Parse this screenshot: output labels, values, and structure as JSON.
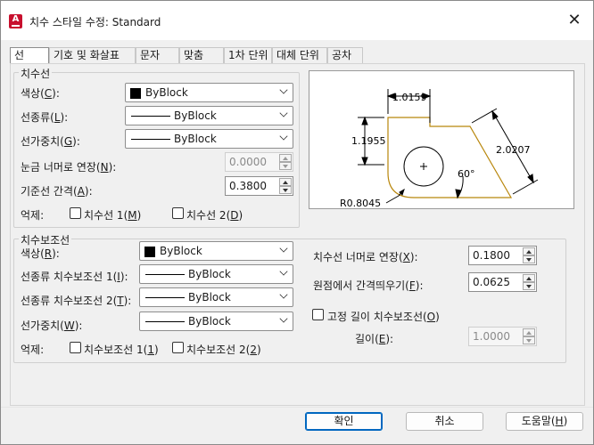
{
  "window": {
    "title": "치수 스타일 수정: Standard"
  },
  "tabs": [
    {
      "label": "선"
    },
    {
      "label": "기호 및 화살표"
    },
    {
      "label": "문자"
    },
    {
      "label": "맞춤"
    },
    {
      "label": "1차 단위"
    },
    {
      "label": "대체 단위"
    },
    {
      "label": "공차"
    }
  ],
  "dim_lines": {
    "title": "치수선",
    "color": {
      "label": "색상(",
      "key": "C",
      "end": "):",
      "value": "ByBlock"
    },
    "linetype": {
      "label": "선종류(",
      "key": "L",
      "end": "):",
      "value": "ByBlock"
    },
    "lineweight": {
      "label": "선가중치(",
      "key": "G",
      "end": "):",
      "value": "ByBlock"
    },
    "extend_ticks": {
      "label": "눈금 너머로 연장(",
      "key": "N",
      "end": "):",
      "value": "0.0000"
    },
    "baseline_spacing": {
      "label": "기준선 간격(",
      "key": "A",
      "end": "):",
      "value": "0.3800"
    },
    "suppress": {
      "label": "억제:",
      "opt1": {
        "label": "치수선 1(",
        "key": "M",
        "end": ")"
      },
      "opt2": {
        "label": "치수선 2(",
        "key": "D",
        "end": ")"
      }
    }
  },
  "ext_lines": {
    "title": "치수보조선",
    "color": {
      "label": "색상(",
      "key": "R",
      "end": "):",
      "value": "ByBlock"
    },
    "linetype1": {
      "label": "선종류 치수보조선 1(",
      "key": "I",
      "end": "):",
      "value": "ByBlock"
    },
    "linetype2": {
      "label": "선종류 치수보조선 2(",
      "key": "T",
      "end": "):",
      "value": "ByBlock"
    },
    "lineweight": {
      "label": "선가중치(",
      "key": "W",
      "end": "):",
      "value": "ByBlock"
    },
    "suppress": {
      "label": "억제:",
      "opt1": {
        "label": "치수보조선 1(",
        "key": "1",
        "end": ")"
      },
      "opt2": {
        "label": "치수보조선 2(",
        "key": "2",
        "end": ")"
      }
    },
    "extend_beyond": {
      "label": "치수선 너머로 연장(",
      "key": "X",
      "end": "):",
      "value": "0.1800"
    },
    "offset_origin": {
      "label": "원점에서 간격띄우기(",
      "key": "F",
      "end": "):",
      "value": "0.0625"
    },
    "fixed_length": {
      "label": "고정 길이 치수보조선(",
      "key": "O",
      "end": ")"
    },
    "length": {
      "label": "길이(",
      "key": "E",
      "end": "):",
      "value": "1.0000"
    }
  },
  "preview": {
    "dim_top": "1.0159",
    "dim_left": "1.1955",
    "dim_right": "2.0207",
    "angle": "60°",
    "radius": "R0.8045"
  },
  "buttons": {
    "ok": "확인",
    "cancel": "취소",
    "help_label": "도움말(",
    "help_key": "H",
    "help_end": ")"
  },
  "colors": {
    "accent": "#0067c0",
    "drawing": "#b8860b"
  }
}
